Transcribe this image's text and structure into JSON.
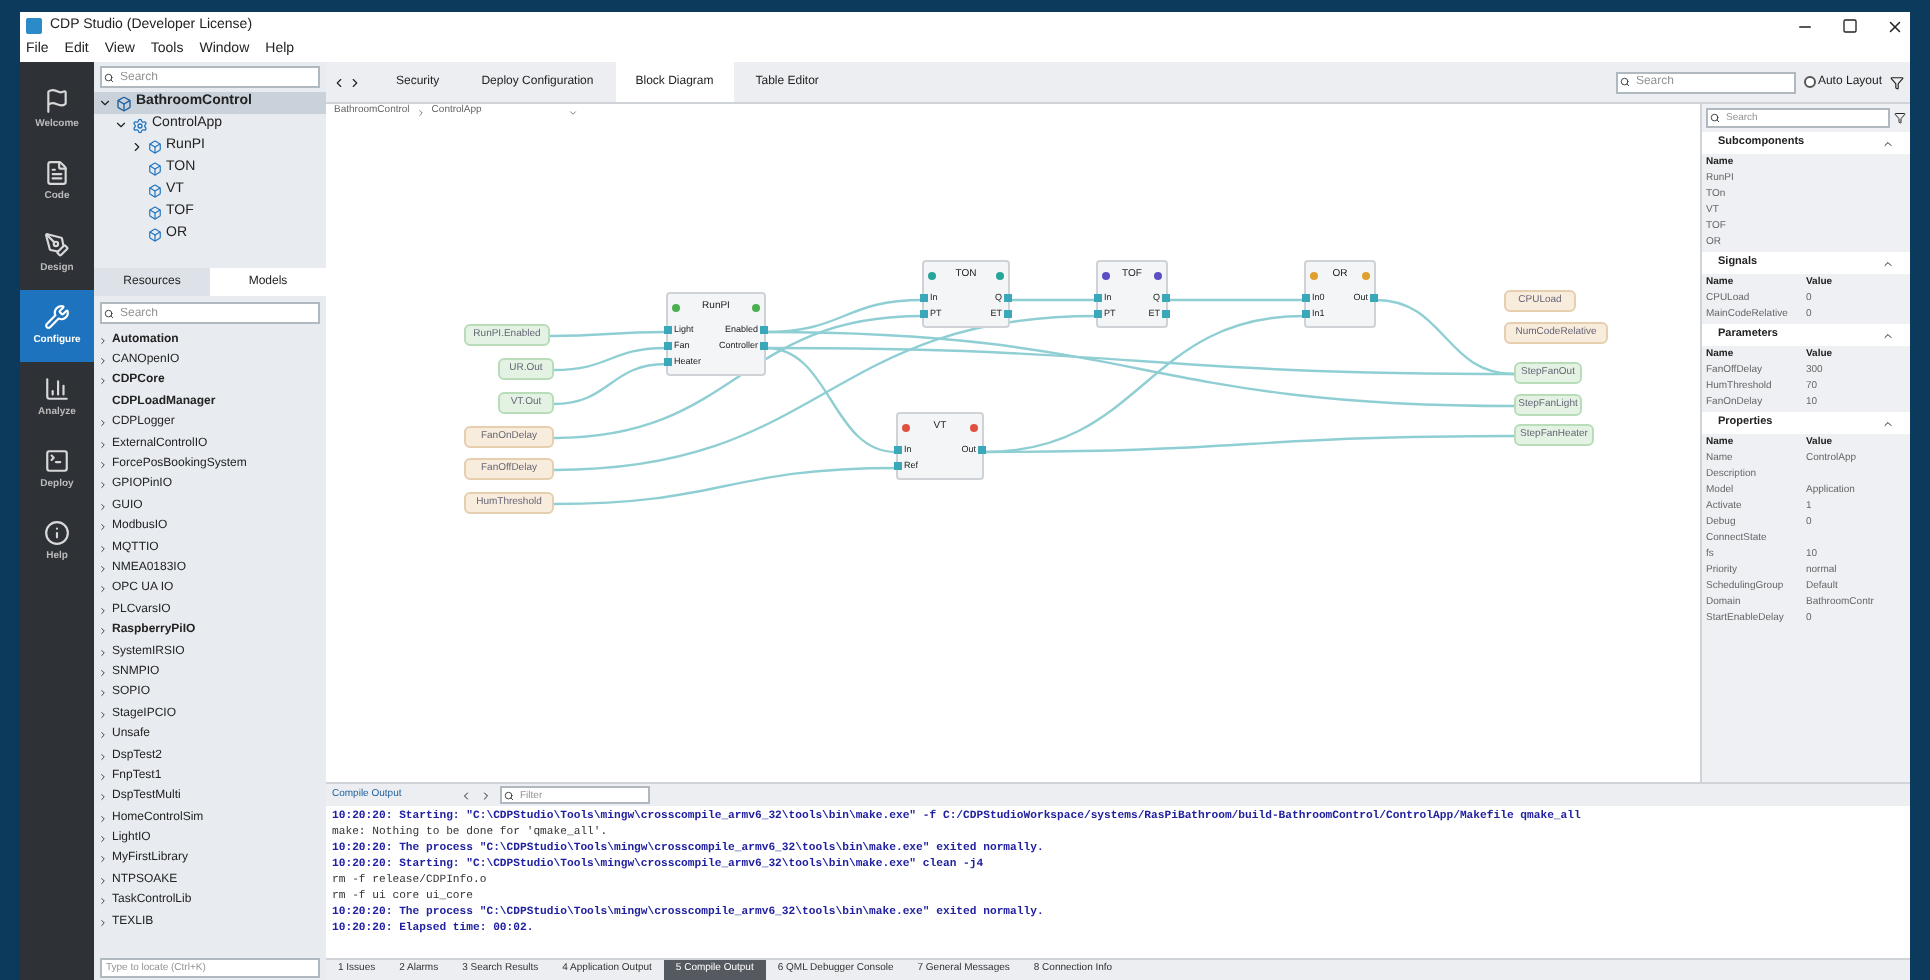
{
  "window": {
    "title": "CDP Studio (Developer License)"
  },
  "menu": [
    "File",
    "Edit",
    "View",
    "Tools",
    "Window",
    "Help"
  ],
  "rail": [
    {
      "label": "Welcome",
      "selected": false
    },
    {
      "label": "Code",
      "selected": false
    },
    {
      "label": "Design",
      "selected": false
    },
    {
      "label": "Configure",
      "selected": true
    },
    {
      "label": "Analyze",
      "selected": false
    },
    {
      "label": "Deploy",
      "selected": false
    },
    {
      "label": "Help",
      "selected": false
    }
  ],
  "project_search": {
    "placeholder": "Search"
  },
  "project_tree": [
    {
      "label": "BathroomControl",
      "kind": "system",
      "expanded": true,
      "selected": true,
      "children": [
        {
          "label": "ControlApp",
          "kind": "app",
          "expanded": true,
          "selected": false,
          "children": [
            {
              "label": "RunPI",
              "kind": "block",
              "expanded": false,
              "selected": false
            },
            {
              "label": "TON",
              "kind": "block",
              "selected": false
            },
            {
              "label": "VT",
              "kind": "block",
              "selected": false
            },
            {
              "label": "TOF",
              "kind": "block",
              "selected": false
            },
            {
              "label": "OR",
              "kind": "block",
              "selected": false
            }
          ]
        }
      ]
    }
  ],
  "panel_tabs": [
    {
      "label": "Resources",
      "selected": false
    },
    {
      "label": "Models",
      "selected": true
    }
  ],
  "library_search": {
    "placeholder": "Search"
  },
  "library": [
    {
      "label": "Automation",
      "bold": true,
      "expandable": true
    },
    {
      "label": "CANOpenIO",
      "bold": false,
      "expandable": true
    },
    {
      "label": "CDPCore",
      "bold": true,
      "expandable": true
    },
    {
      "label": "CDPLoadManager",
      "bold": true,
      "expandable": false
    },
    {
      "label": "CDPLogger",
      "bold": false,
      "expandable": true
    },
    {
      "label": "ExternalControlIO",
      "bold": false,
      "expandable": true
    },
    {
      "label": "ForcePosBookingSystem",
      "bold": false,
      "expandable": true
    },
    {
      "label": "GPIOPinIO",
      "bold": false,
      "expandable": true
    },
    {
      "label": "GUIO",
      "bold": false,
      "expandable": true
    },
    {
      "label": "ModbusIO",
      "bold": false,
      "expandable": true
    },
    {
      "label": "MQTTIO",
      "bold": false,
      "expandable": true
    },
    {
      "label": "NMEA0183IO",
      "bold": false,
      "expandable": true
    },
    {
      "label": "OPC UA IO",
      "bold": false,
      "expandable": true
    },
    {
      "label": "PLCvarsIO",
      "bold": false,
      "expandable": true
    },
    {
      "label": "RaspberryPiIO",
      "bold": true,
      "expandable": true
    },
    {
      "label": "SystemIRSIO",
      "bold": false,
      "expandable": true
    },
    {
      "label": "SNMPIO",
      "bold": false,
      "expandable": true
    },
    {
      "label": "SOPIO",
      "bold": false,
      "expandable": true
    },
    {
      "label": "StageIPCIO",
      "bold": false,
      "expandable": true
    },
    {
      "label": "Unsafe",
      "bold": false,
      "expandable": true
    },
    {
      "label": "DspTest2",
      "bold": false,
      "expandable": true
    },
    {
      "label": "FnpTest1",
      "bold": false,
      "expandable": true
    },
    {
      "label": "DspTestMulti",
      "bold": false,
      "expandable": true
    },
    {
      "label": "HomeControlSim",
      "bold": false,
      "expandable": true
    },
    {
      "label": "LightIO",
      "bold": false,
      "expandable": true
    },
    {
      "label": "MyFirstLibrary",
      "bold": false,
      "expandable": true
    },
    {
      "label": "NTPSOAKE",
      "bold": false,
      "expandable": true
    },
    {
      "label": "TaskControlLib",
      "bold": false,
      "expandable": true
    },
    {
      "label": "TEXLIB",
      "bold": false,
      "expandable": true
    }
  ],
  "locator": {
    "placeholder": "Type to locate (Ctrl+K)"
  },
  "editor_tabs": [
    {
      "label": "Security",
      "selected": false
    },
    {
      "label": "Deploy Configuration",
      "selected": false
    },
    {
      "label": "Block Diagram",
      "selected": true
    },
    {
      "label": "Table Editor",
      "selected": false
    }
  ],
  "editor_search": {
    "placeholder": "Search"
  },
  "auto_layout": {
    "label": "Auto Layout",
    "checked": false
  },
  "breadcrumb": [
    "BathroomControl",
    "ControlApp"
  ],
  "diagram": {
    "blocks": [
      {
        "name": "RunPI",
        "color": "#4caf50",
        "inputs": [
          "Light",
          "Fan",
          "Heater"
        ],
        "outputs": [
          "Enabled",
          "Controller"
        ]
      },
      {
        "name": "TON",
        "color": "#26a69a",
        "inputs": [
          "In",
          "PT"
        ],
        "outputs": [
          "Q",
          "ET"
        ]
      },
      {
        "name": "TOF",
        "color": "#5c4fc4",
        "inputs": [
          "In",
          "PT"
        ],
        "outputs": [
          "Q",
          "ET"
        ]
      },
      {
        "name": "OR",
        "color": "#e0a030",
        "inputs": [
          "In0",
          "In1"
        ],
        "outputs": [
          "Out"
        ]
      },
      {
        "name": "VT",
        "color": "#e05040",
        "inputs": [
          "In",
          "Ref"
        ],
        "outputs": [
          "Out"
        ]
      }
    ],
    "inputs": [
      {
        "label": "RunPI.Enabled",
        "kind": "signal"
      },
      {
        "label": "UR.Out",
        "kind": "signal"
      },
      {
        "label": "VT.Out",
        "kind": "signal"
      },
      {
        "label": "FanOnDelay",
        "kind": "parameter"
      },
      {
        "label": "FanOffDelay",
        "kind": "parameter"
      },
      {
        "label": "HumThreshold",
        "kind": "parameter"
      }
    ],
    "outputs": [
      {
        "label": "CPULoad",
        "kind": "parameter"
      },
      {
        "label": "NumCodeRelative",
        "kind": "parameter"
      },
      {
        "label": "StepFanOut",
        "kind": "signal"
      },
      {
        "label": "StepFanLight",
        "kind": "signal"
      },
      {
        "label": "StepFanHeater",
        "kind": "signal"
      }
    ]
  },
  "right_search": {
    "placeholder": "Search"
  },
  "sections": [
    {
      "title": "Subcomponents",
      "columns": [
        "Name"
      ],
      "rows": [
        [
          "RunPI"
        ],
        [
          "TOn"
        ],
        [
          "VT"
        ],
        [
          "TOF"
        ],
        [
          "OR"
        ]
      ]
    },
    {
      "title": "Signals",
      "columns": [
        "Name",
        "Value"
      ],
      "rows": [
        [
          "CPULoad",
          "0"
        ],
        [
          "MainCodeRelative",
          "0"
        ]
      ]
    },
    {
      "title": "Parameters",
      "columns": [
        "Name",
        "Value"
      ],
      "rows": [
        [
          "FanOffDelay",
          "300"
        ],
        [
          "HumThreshold",
          "70"
        ],
        [
          "FanOnDelay",
          "10"
        ]
      ]
    },
    {
      "title": "Properties",
      "columns": [
        "Name",
        "Value"
      ],
      "rows": [
        [
          "Name",
          "ControlApp"
        ],
        [
          "Description",
          ""
        ],
        [
          "Model",
          "Application"
        ],
        [
          "Activate",
          "1"
        ],
        [
          "Debug",
          "0"
        ],
        [
          "ConnectState",
          ""
        ],
        [
          "fs",
          "10"
        ],
        [
          "Priority",
          "normal"
        ],
        [
          "SchedulingGroup",
          "Default"
        ],
        [
          "Domain",
          "BathroomContr"
        ],
        [
          "StartEnableDelay",
          "0"
        ]
      ]
    }
  ],
  "console": {
    "title": "Compile Output",
    "filter": {
      "placeholder": "Filter"
    },
    "lines": [
      {
        "text": "10:20:20: Starting: \"C:\\CDPStudio\\Tools\\mingw\\crosscompile_armv6_32\\tools\\bin\\make.exe\" -f C:/CDPStudioWorkspace/systems/RasPiBathroom/build-BathroomControl/ControlApp/Makefile qmake_all",
        "kind": "info"
      },
      {
        "text": "make: Nothing to be done for 'qmake_all'.",
        "kind": "plain"
      },
      {
        "text": "10:20:20: The process \"C:\\CDPStudio\\Tools\\mingw\\crosscompile_armv6_32\\tools\\bin\\make.exe\" exited normally.",
        "kind": "info"
      },
      {
        "text": "10:20:20: Starting: \"C:\\CDPStudio\\Tools\\mingw\\crosscompile_armv6_32\\tools\\bin\\make.exe\" clean -j4",
        "kind": "info"
      },
      {
        "text": "rm -f release/CDPInfo.o",
        "kind": "plain"
      },
      {
        "text": "rm -f ui core ui_core",
        "kind": "plain"
      },
      {
        "text": "10:20:20: The process \"C:\\CDPStudio\\Tools\\mingw\\crosscompile_armv6_32\\tools\\bin\\make.exe\" exited normally.",
        "kind": "info"
      },
      {
        "text": "10:20:20: Elapsed time: 00:02.",
        "kind": "info"
      }
    ]
  },
  "bottom_tabs": [
    {
      "label": "1 Issues",
      "selected": false
    },
    {
      "label": "2 Alarms",
      "selected": false
    },
    {
      "label": "3 Search Results",
      "selected": false
    },
    {
      "label": "4 Application Output",
      "selected": false
    },
    {
      "label": "5 Compile Output",
      "selected": true
    },
    {
      "label": "6 QML Debugger Console",
      "selected": false
    },
    {
      "label": "7 General Messages",
      "selected": false
    },
    {
      "label": "8 Connection Info",
      "selected": false
    }
  ]
}
